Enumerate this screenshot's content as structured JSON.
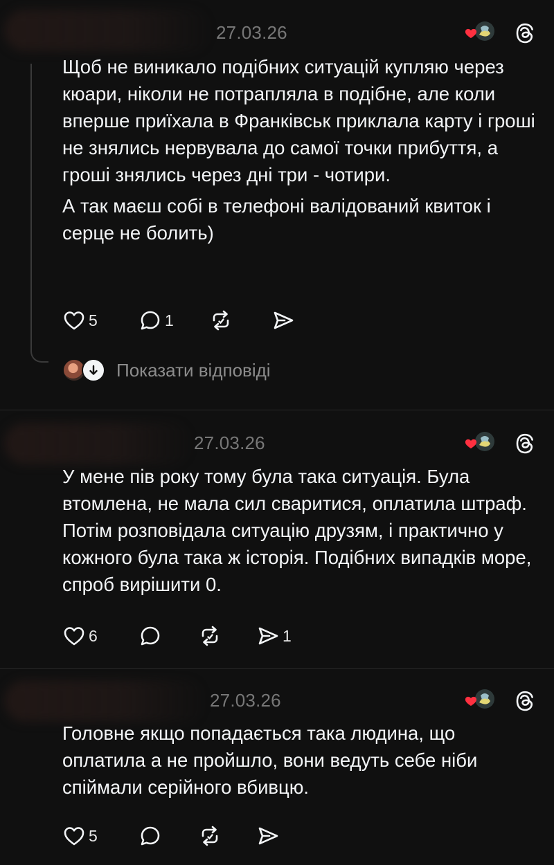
{
  "comments": [
    {
      "date": "27.03.26",
      "paragraphs": [
        "Щоб не виникало подібних ситуацій купляю через кюари, ніколи не потрапляла в подібне, але коли вперше приїхала в Франківськ приклала карту і гроші не знялись нервувала до самої точки прибуття, а гроші знялись через дні три - чотири.",
        "А так маєш собі в телефоні валідований квиток і серце не болить)"
      ],
      "likes": "5",
      "replies": "1",
      "reposts": "",
      "shares": "",
      "show_replies_label": "Показати відповіді"
    },
    {
      "date": "27.03.26",
      "paragraphs": [
        "У мене пів року тому була така ситуація. Була втомлена, не мала сил сваритися, оплатила штраф. Потім розповідала ситуацію друзям, і практично у кожного була така ж історія. Подібних випадків море, спроб вирішити 0."
      ],
      "likes": "6",
      "replies": "",
      "reposts": "",
      "shares": "1"
    },
    {
      "date": "27.03.26",
      "paragraphs": [
        "Головне якщо попадається така людина, що оплатила а не пройшло, вони ведуть себе ніби спіймали серійного вбивцю."
      ],
      "likes": "5",
      "replies": "",
      "reposts": "",
      "shares": ""
    }
  ],
  "colors": {
    "background": "#101010",
    "text": "#f3f5f7",
    "muted": "#777777",
    "heart": "#ff3040",
    "divider": "#2a2a2a"
  },
  "icons": [
    "heart-icon",
    "comment-icon",
    "repost-icon",
    "share-icon",
    "threads-logo-icon",
    "arrow-down-icon"
  ]
}
